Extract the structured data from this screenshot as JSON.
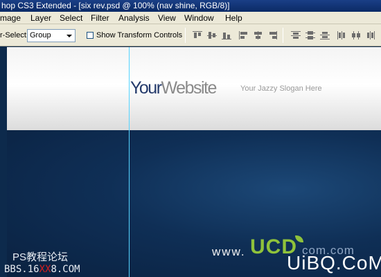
{
  "window": {
    "title": "hop CS3 Extended - [six rev.psd @ 100% (nav shine, RGB/8)]"
  },
  "menu": {
    "items": [
      "mage",
      "Layer",
      "Select",
      "Filter",
      "Analysis",
      "View",
      "Window",
      "Help"
    ]
  },
  "options": {
    "auto_select_label": "r-Select:",
    "auto_select_value": "Group",
    "show_transform_label": "Show Transform Controls",
    "show_transform_checked": false
  },
  "canvas": {
    "logo_your": "Your",
    "logo_website": "Website",
    "slogan": "Your Jazzy Slogan Here"
  },
  "watermarks": {
    "ps_text": "PS教程论坛",
    "bbs_prefix": "BBS.16",
    "bbs_red": "XX",
    "bbs_suffix": "8.COM",
    "www": "www.",
    "ucd": "UCD",
    "com_faint": "com.com",
    "uibq": "UiBQ.CoM"
  },
  "colors": {
    "titlebar": "#0b2a66",
    "menubar": "#ece9d8",
    "canvas_dark": "#0f2f56",
    "guide": "#55d4ff",
    "logo_dark": "#243a6b"
  }
}
